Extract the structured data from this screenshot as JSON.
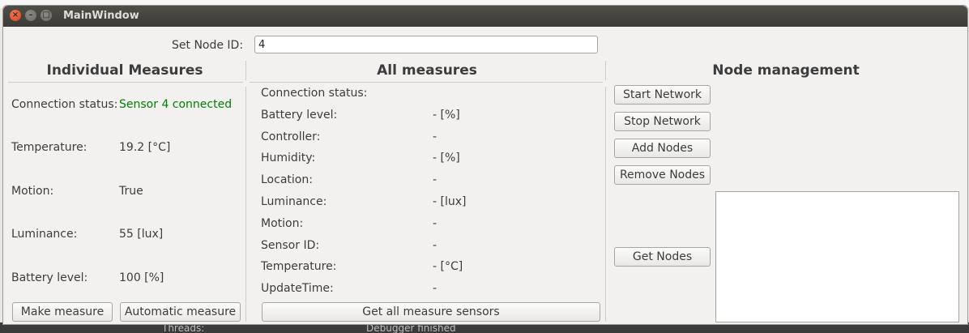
{
  "background": {
    "bottom_left_text": "Threads:",
    "bottom_right_text": "Debugger finished"
  },
  "window": {
    "title": "MainWindow"
  },
  "node_id": {
    "label": "Set Node ID:",
    "value": "4"
  },
  "individual": {
    "heading": "Individual Measures",
    "rows": [
      {
        "label": "Connection status:",
        "value": "Sensor 4 connected"
      },
      {
        "label": "Temperature:",
        "value": "19.2 [°C]"
      },
      {
        "label": "Motion:",
        "value": "True"
      },
      {
        "label": "Luminance:",
        "value": "55 [lux]"
      },
      {
        "label": "Battery level:",
        "value": "100 [%]"
      }
    ],
    "make_measure": "Make measure",
    "automatic_measure": "Automatic measure"
  },
  "all": {
    "heading": "All measures",
    "connection_label": "Connection status:",
    "rows": [
      {
        "label": "Battery level:",
        "value": "- [%]"
      },
      {
        "label": "Controller:",
        "value": "-"
      },
      {
        "label": "Humidity:",
        "value": "- [%]"
      },
      {
        "label": "Location:",
        "value": "-"
      },
      {
        "label": "Luminance:",
        "value": "- [lux]"
      },
      {
        "label": "Motion:",
        "value": "-"
      },
      {
        "label": "Sensor ID:",
        "value": "-"
      },
      {
        "label": "Temperature:",
        "value": "- [°C]"
      },
      {
        "label": "UpdateTime:",
        "value": "-"
      }
    ],
    "get_all": "Get all measure sensors"
  },
  "node_mgmt": {
    "heading": "Node management",
    "start_network": "Start Network",
    "stop_network": "Stop Network",
    "add_nodes": "Add Nodes",
    "remove_nodes": "Remove Nodes",
    "get_nodes": "Get Nodes"
  }
}
